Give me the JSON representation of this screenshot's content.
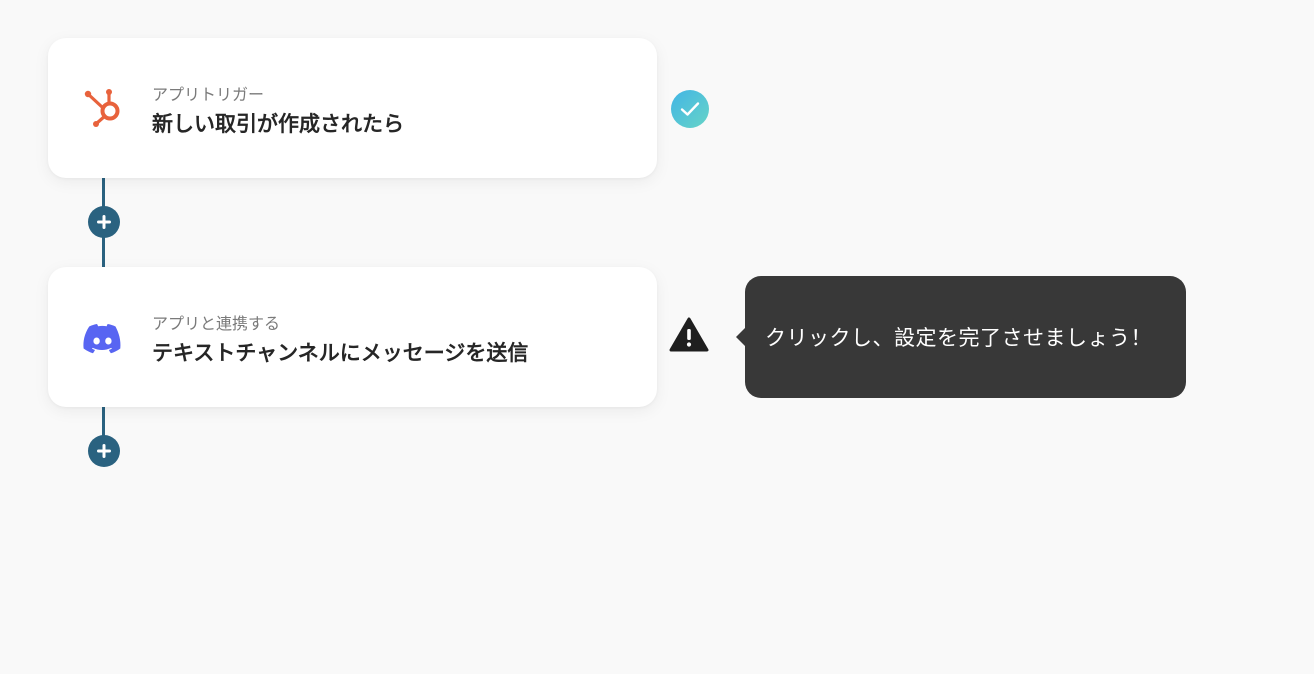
{
  "steps": [
    {
      "app_name": "HubSpot",
      "icon": "hubspot-icon",
      "subtitle": "アプリトリガー",
      "title": "新しい取引が作成されたら",
      "status": "complete"
    },
    {
      "app_name": "Discord",
      "icon": "discord-icon",
      "subtitle": "アプリと連携する",
      "title": "テキストチャンネルにメッセージを送信",
      "status": "warning"
    }
  ],
  "tooltip": {
    "text": "クリックし、設定を完了させましょう！"
  },
  "colors": {
    "connector": "#2a6280",
    "hubspot": "#e8623c",
    "discord": "#5865f2",
    "tooltip_bg": "#383838",
    "check_gradient_start": "#42b5e5",
    "check_gradient_end": "#67d4c7"
  }
}
